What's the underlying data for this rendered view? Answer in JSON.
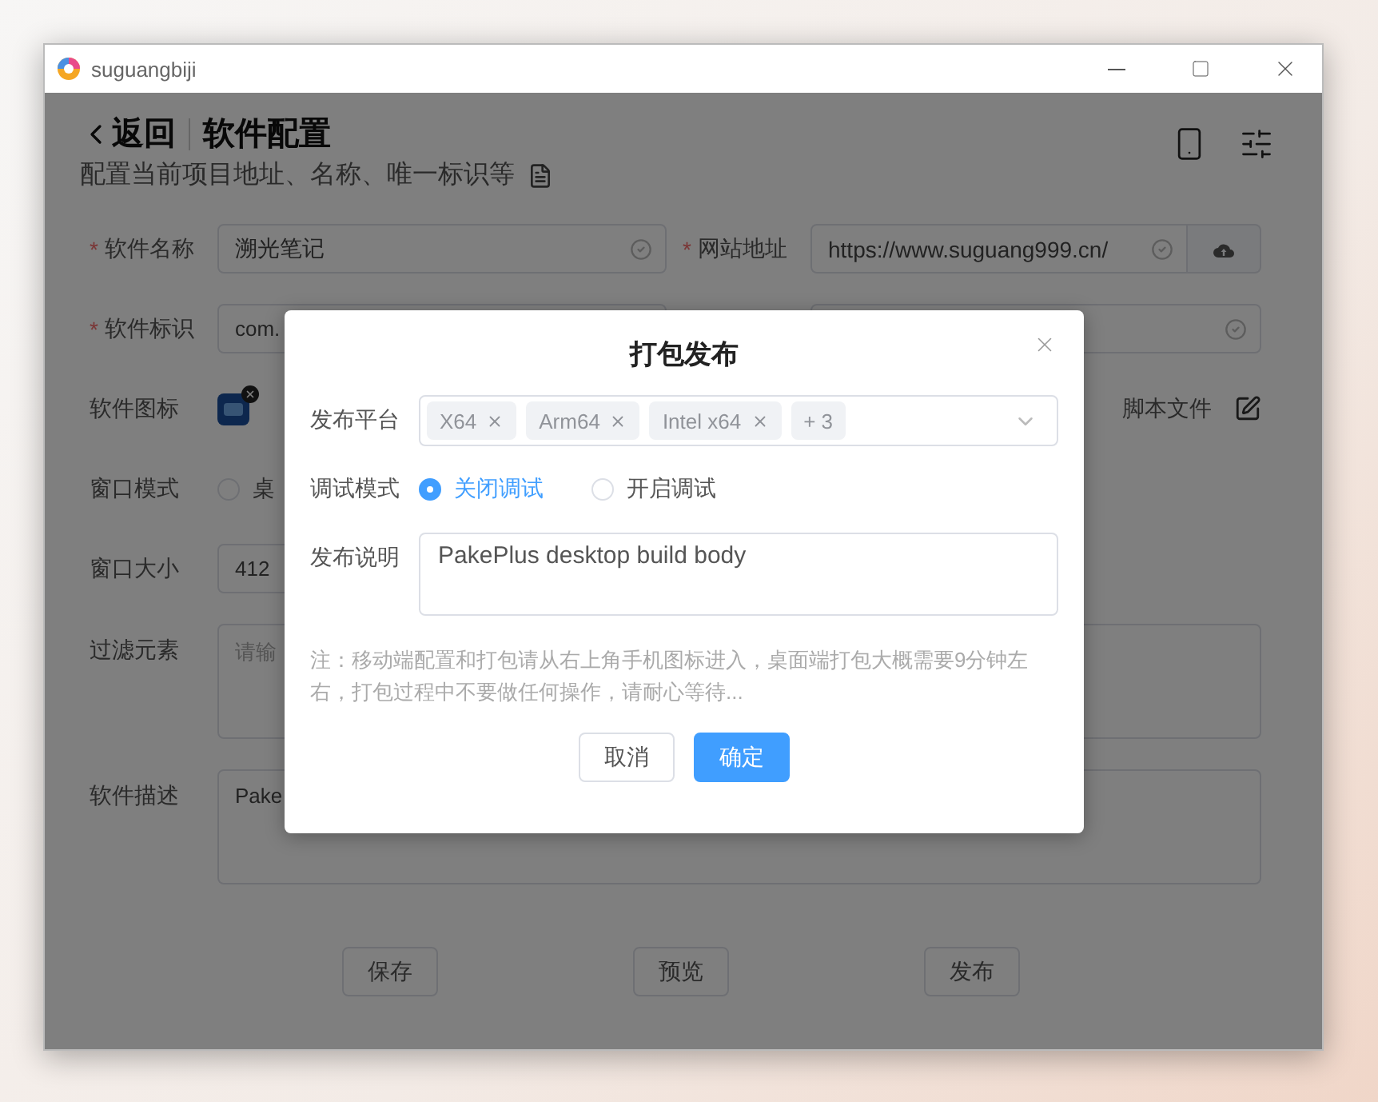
{
  "window": {
    "title": "suguangbiji"
  },
  "header": {
    "back": "返回",
    "title": "软件配置",
    "subtitle": "配置当前项目地址、名称、唯一标识等"
  },
  "fields": {
    "name": {
      "label": "软件名称",
      "mark": "*",
      "value": "溯光笔记"
    },
    "url": {
      "label": "网站地址",
      "mark": "*",
      "value": "https://www.suguang999.cn/"
    },
    "id": {
      "label": "软件标识",
      "mark": "*",
      "value": "com."
    },
    "icon": {
      "label": "软件图标"
    },
    "script": {
      "label": "脚本文件"
    },
    "window_mode": {
      "label": "窗口模式",
      "options": [
        {
          "label": "桌",
          "selected": false
        }
      ]
    },
    "window_size": {
      "label": "窗口大小",
      "value": "412"
    },
    "filter": {
      "label": "过滤元素",
      "placeholder": "请输"
    },
    "description": {
      "label": "软件描述",
      "value": "Pake"
    }
  },
  "actions": [
    "保存",
    "预览",
    "发布"
  ],
  "dialog": {
    "title": "打包发布",
    "platform": {
      "label": "发布平台",
      "tags": [
        "X64",
        "Arm64",
        "Intel x64"
      ],
      "more": "+ 3"
    },
    "debug": {
      "label": "调试模式",
      "options": [
        {
          "label": "关闭调试",
          "selected": true
        },
        {
          "label": "开启调试",
          "selected": false
        }
      ]
    },
    "notes": {
      "label": "发布说明",
      "value": "PakePlus desktop build body"
    },
    "hint": "注：移动端配置和打包请从右上角手机图标进入，桌面端打包大概需要9分钟左右，打包过程中不要做任何操作，请耐心等待...",
    "buttons": [
      {
        "label": "取消",
        "primary": false
      },
      {
        "label": "确定",
        "primary": true
      }
    ]
  }
}
